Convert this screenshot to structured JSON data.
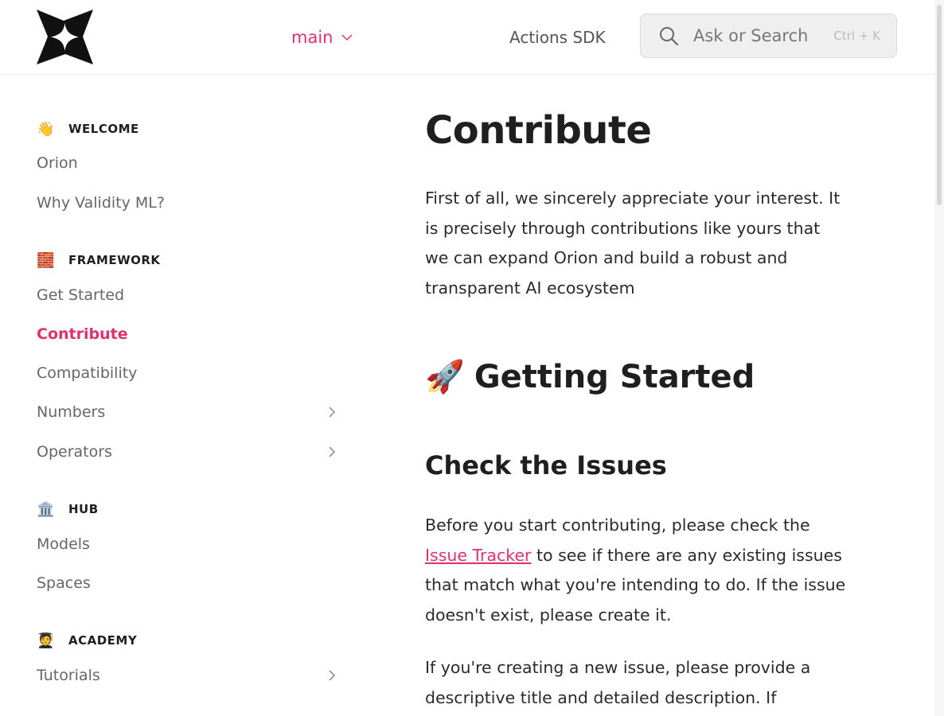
{
  "header": {
    "logo_icon": "sparkle-logo-icon",
    "version": {
      "label": "main",
      "icon": "chevron-down-icon"
    },
    "nav_link": "Actions SDK",
    "search": {
      "icon": "search-icon",
      "placeholder": "Ask or Search",
      "shortcut": "Ctrl + K"
    }
  },
  "sidebar": {
    "sections": [
      {
        "emoji": "👋",
        "title": "WELCOME",
        "items": [
          {
            "label": "Orion"
          },
          {
            "label": "Why Validity ML?"
          }
        ]
      },
      {
        "emoji": "🧱",
        "title": "FRAMEWORK",
        "items": [
          {
            "label": "Get Started"
          },
          {
            "label": "Contribute",
            "active": true
          },
          {
            "label": "Compatibility"
          },
          {
            "label": "Numbers",
            "expandable": true
          },
          {
            "label": "Operators",
            "expandable": true
          }
        ]
      },
      {
        "emoji": "🏛️",
        "title": "HUB",
        "items": [
          {
            "label": "Models"
          },
          {
            "label": "Spaces"
          }
        ]
      },
      {
        "emoji": "🧑‍🎓",
        "title": "ACADEMY",
        "items": [
          {
            "label": "Tutorials",
            "expandable": true
          }
        ]
      }
    ]
  },
  "main": {
    "title": "Contribute",
    "intro": "First of all, we sincerely appreciate your interest. It is precisely through contributions like yours that we can expand Orion and build a robust and transparent AI ecosystem",
    "h2": {
      "emoji": "🚀",
      "text": "Getting Started"
    },
    "h3": "Check the Issues",
    "para2": {
      "before": "Before you start contributing, please check the ",
      "link": "Issue Tracker",
      "after": " to see if there are any existing issues that match what you're intending to do. If the issue doesn't exist, please create it."
    },
    "para3": "If you're creating a new issue, please provide a descriptive title and detailed description. If"
  },
  "colors": {
    "accent": "#e0316e",
    "text": "#1f1f1f",
    "muted": "#666666"
  }
}
